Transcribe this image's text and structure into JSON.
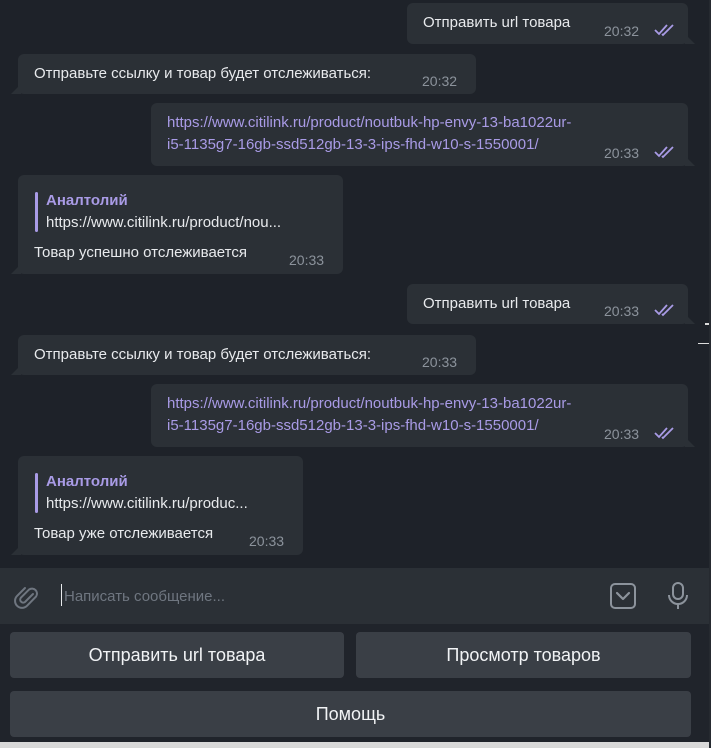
{
  "messages": [
    {
      "id": "m1",
      "direction": "outgoing",
      "text": "Отправить url товара",
      "time": "20:32",
      "read": true
    },
    {
      "id": "m2",
      "direction": "incoming",
      "text": "Отправьте ссылку и товар будет отслеживаться:",
      "time": "20:32"
    },
    {
      "id": "m3",
      "direction": "outgoing",
      "link_lines": [
        "https://www.citilink.ru/product/noutbuk-hp-envy-13-ba1022ur-",
        "i5-1135g7-16gb-ssd512gb-13-3-ips-fhd-w10-s-1550001/"
      ],
      "time": "20:33",
      "read": true
    },
    {
      "id": "m4",
      "direction": "incoming",
      "reply_name": "Аналтолий",
      "reply_text": "https://www.citilink.ru/product/nou...",
      "text": "Товар успешно отслеживается",
      "time": "20:33"
    },
    {
      "id": "m5",
      "direction": "outgoing",
      "text": "Отправить url товара",
      "time": "20:33",
      "read": true
    },
    {
      "id": "m6",
      "direction": "incoming",
      "text": "Отправьте ссылку и товар будет отслеживаться:",
      "time": "20:33"
    },
    {
      "id": "m7",
      "direction": "outgoing",
      "link_lines": [
        "https://www.citilink.ru/product/noutbuk-hp-envy-13-ba1022ur-",
        "i5-1135g7-16gb-ssd512gb-13-3-ips-fhd-w10-s-1550001/"
      ],
      "time": "20:33",
      "read": true
    },
    {
      "id": "m8",
      "direction": "incoming",
      "reply_name": "Аналтолий",
      "reply_text": "https://www.citilink.ru/produc...",
      "text": "Товар уже отслеживается",
      "time": "20:33"
    }
  ],
  "composer": {
    "placeholder": "Написать сообщение...",
    "icons": [
      "paperclip-icon",
      "bot-keyboard-icon",
      "microphone-icon"
    ]
  },
  "keyboard": {
    "send_url": "Отправить url товара",
    "view_products": "Просмотр товаров",
    "help": "Помощь"
  },
  "colors": {
    "background": "#1e2229",
    "bubble": "#2b3036",
    "link": "#a99be6",
    "time": "#8c939c",
    "read_checks": "#a99be6",
    "keyboard_button": "#3a3f46"
  }
}
